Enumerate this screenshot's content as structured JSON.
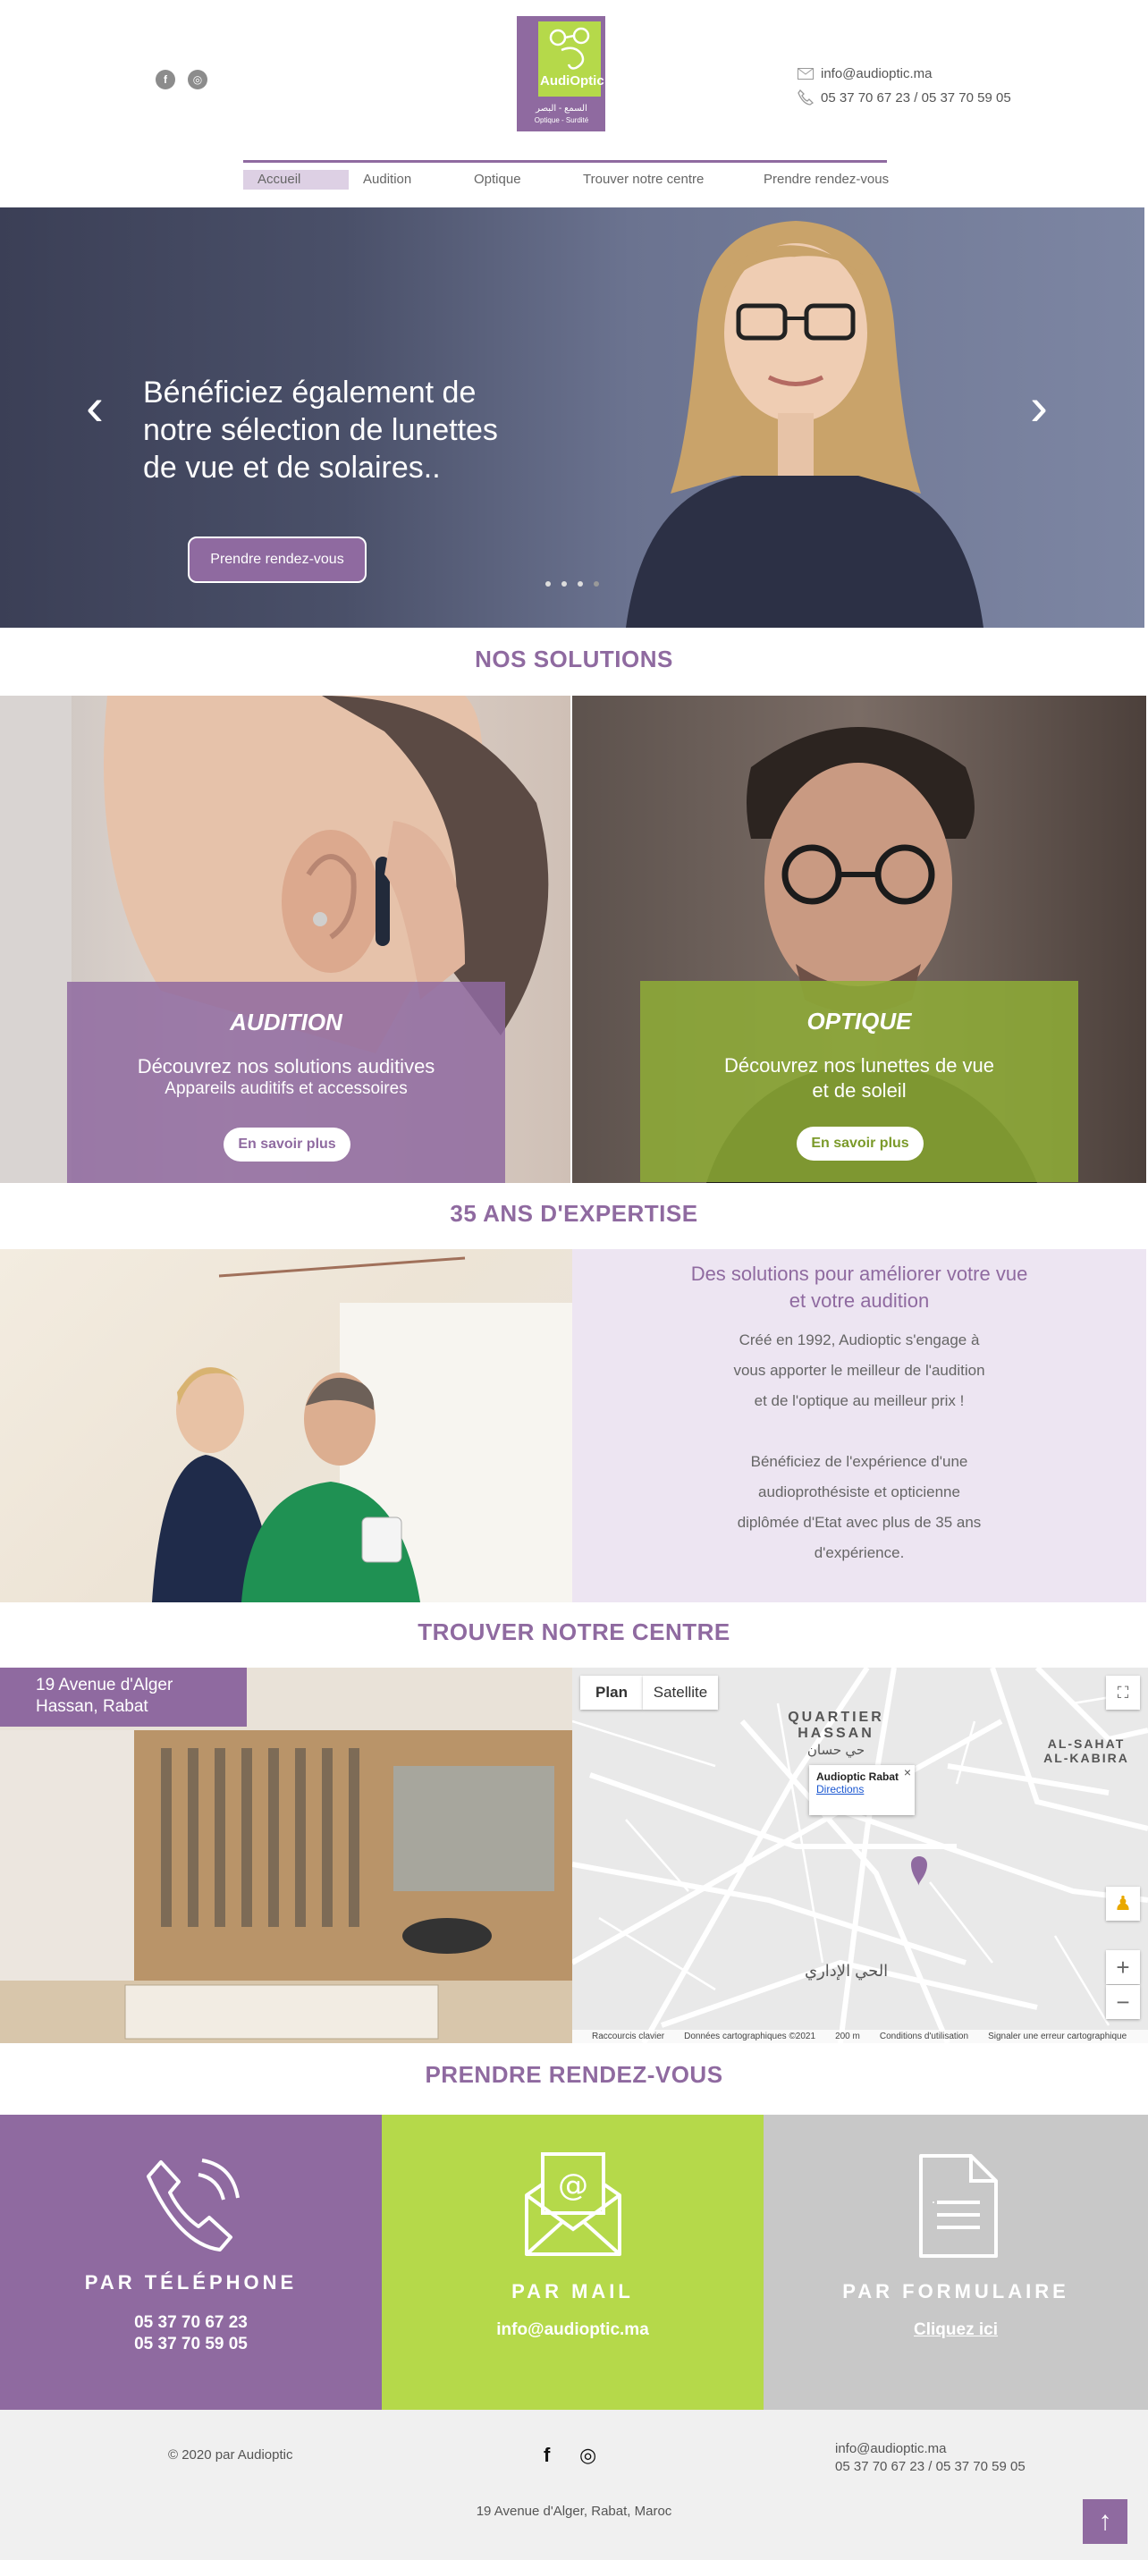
{
  "header": {
    "social": [
      {
        "icon": "facebook-icon",
        "glyph": "f"
      },
      {
        "icon": "instagram-icon",
        "glyph": "◎"
      }
    ],
    "logo": {
      "name": "AudiOptic",
      "arabic": "السمع - البصر",
      "sub": "Optique - Surdité"
    },
    "email": "info@audioptic.ma",
    "phone": "05 37 70 67 23 / 05 37 70 59 05",
    "menu": [
      "Accueil",
      "Audition",
      "Optique",
      "Trouver notre centre",
      "Prendre rendez-vous"
    ]
  },
  "hero": {
    "text": "Bénéficiez également de notre sélection de lunettes de vue et de solaires..",
    "button": "Prendre rendez-vous",
    "prev": "‹",
    "next": "›"
  },
  "solutions": {
    "title": "NOS SOLUTIONS",
    "audition": {
      "title": "AUDITION",
      "text": "Découvrez nos solutions auditives",
      "sub": "Appareils auditifs et accessoires",
      "button": "En savoir plus"
    },
    "optique": {
      "title": "OPTIQUE",
      "text1": "Découvrez nos lunettes de vue",
      "text2": "et de soleil",
      "button": "En savoir plus"
    }
  },
  "expertise": {
    "title": "35 ANS D'EXPERTISE",
    "heading1": "Des solutions pour améliorer votre vue",
    "heading2": "et votre audition",
    "lines": [
      "Créé en 1992, Audioptic s'engage à",
      "vous apporter le meilleur de l'audition",
      "et de l'optique au meilleur prix !",
      "",
      "Bénéficiez de l'expérience d'une",
      "audioprothésiste et opticienne",
      "diplômée d'Etat avec plus de 35 ans",
      "d'expérience."
    ]
  },
  "centre": {
    "title": "TROUVER NOTRE CENTRE",
    "address1": "19 Avenue d'Alger",
    "address2": "Hassan, Rabat",
    "map": {
      "tab_plan": "Plan",
      "tab_satellite": "Satellite",
      "popup_title": "Audioptic Rabat",
      "popup_link": "Directions",
      "popup_close": "×",
      "label_hassan1": "QUARTIER",
      "label_hassan2": "HASSAN",
      "label_hassan_ar": "حي حسان",
      "label_kabira1": "AL-SAHAT",
      "label_kabira2": "AL-KABIRA",
      "label_idari": "الحي الإداري",
      "fullscreen": "⛶",
      "pegman": "♟",
      "zoom_in": "+",
      "zoom_out": "−",
      "footer": [
        "Raccourcis clavier",
        "Données cartographiques ©2021",
        "200 m",
        "Conditions d'utilisation",
        "Signaler une erreur cartographique"
      ]
    }
  },
  "rdv": {
    "title": "PRENDRE RENDEZ-VOUS",
    "phone": {
      "title": "PAR TÉLÉPHONE",
      "line1": "05 37 70 67 23",
      "line2": "05 37 70 59 05"
    },
    "mail": {
      "title": "PAR MAIL",
      "line1": "info@audioptic.ma"
    },
    "form": {
      "title": "PAR FORMULAIRE",
      "line1": "Cliquez ici"
    }
  },
  "footer": {
    "copyright": "© 2020 par Audioptic",
    "email": "info@audioptic.ma",
    "phone": "05 37 70 67 23 / 05 37 70 59 05",
    "address": "19 Avenue d'Alger, Rabat, Maroc",
    "facebook": "f",
    "instagram": "◎",
    "to_top": "↑"
  },
  "colors": {
    "purple": "#8f6aa0",
    "green": "#b5d94a",
    "grey": "#c8c8c8",
    "light_purple": "#ede5f2"
  }
}
